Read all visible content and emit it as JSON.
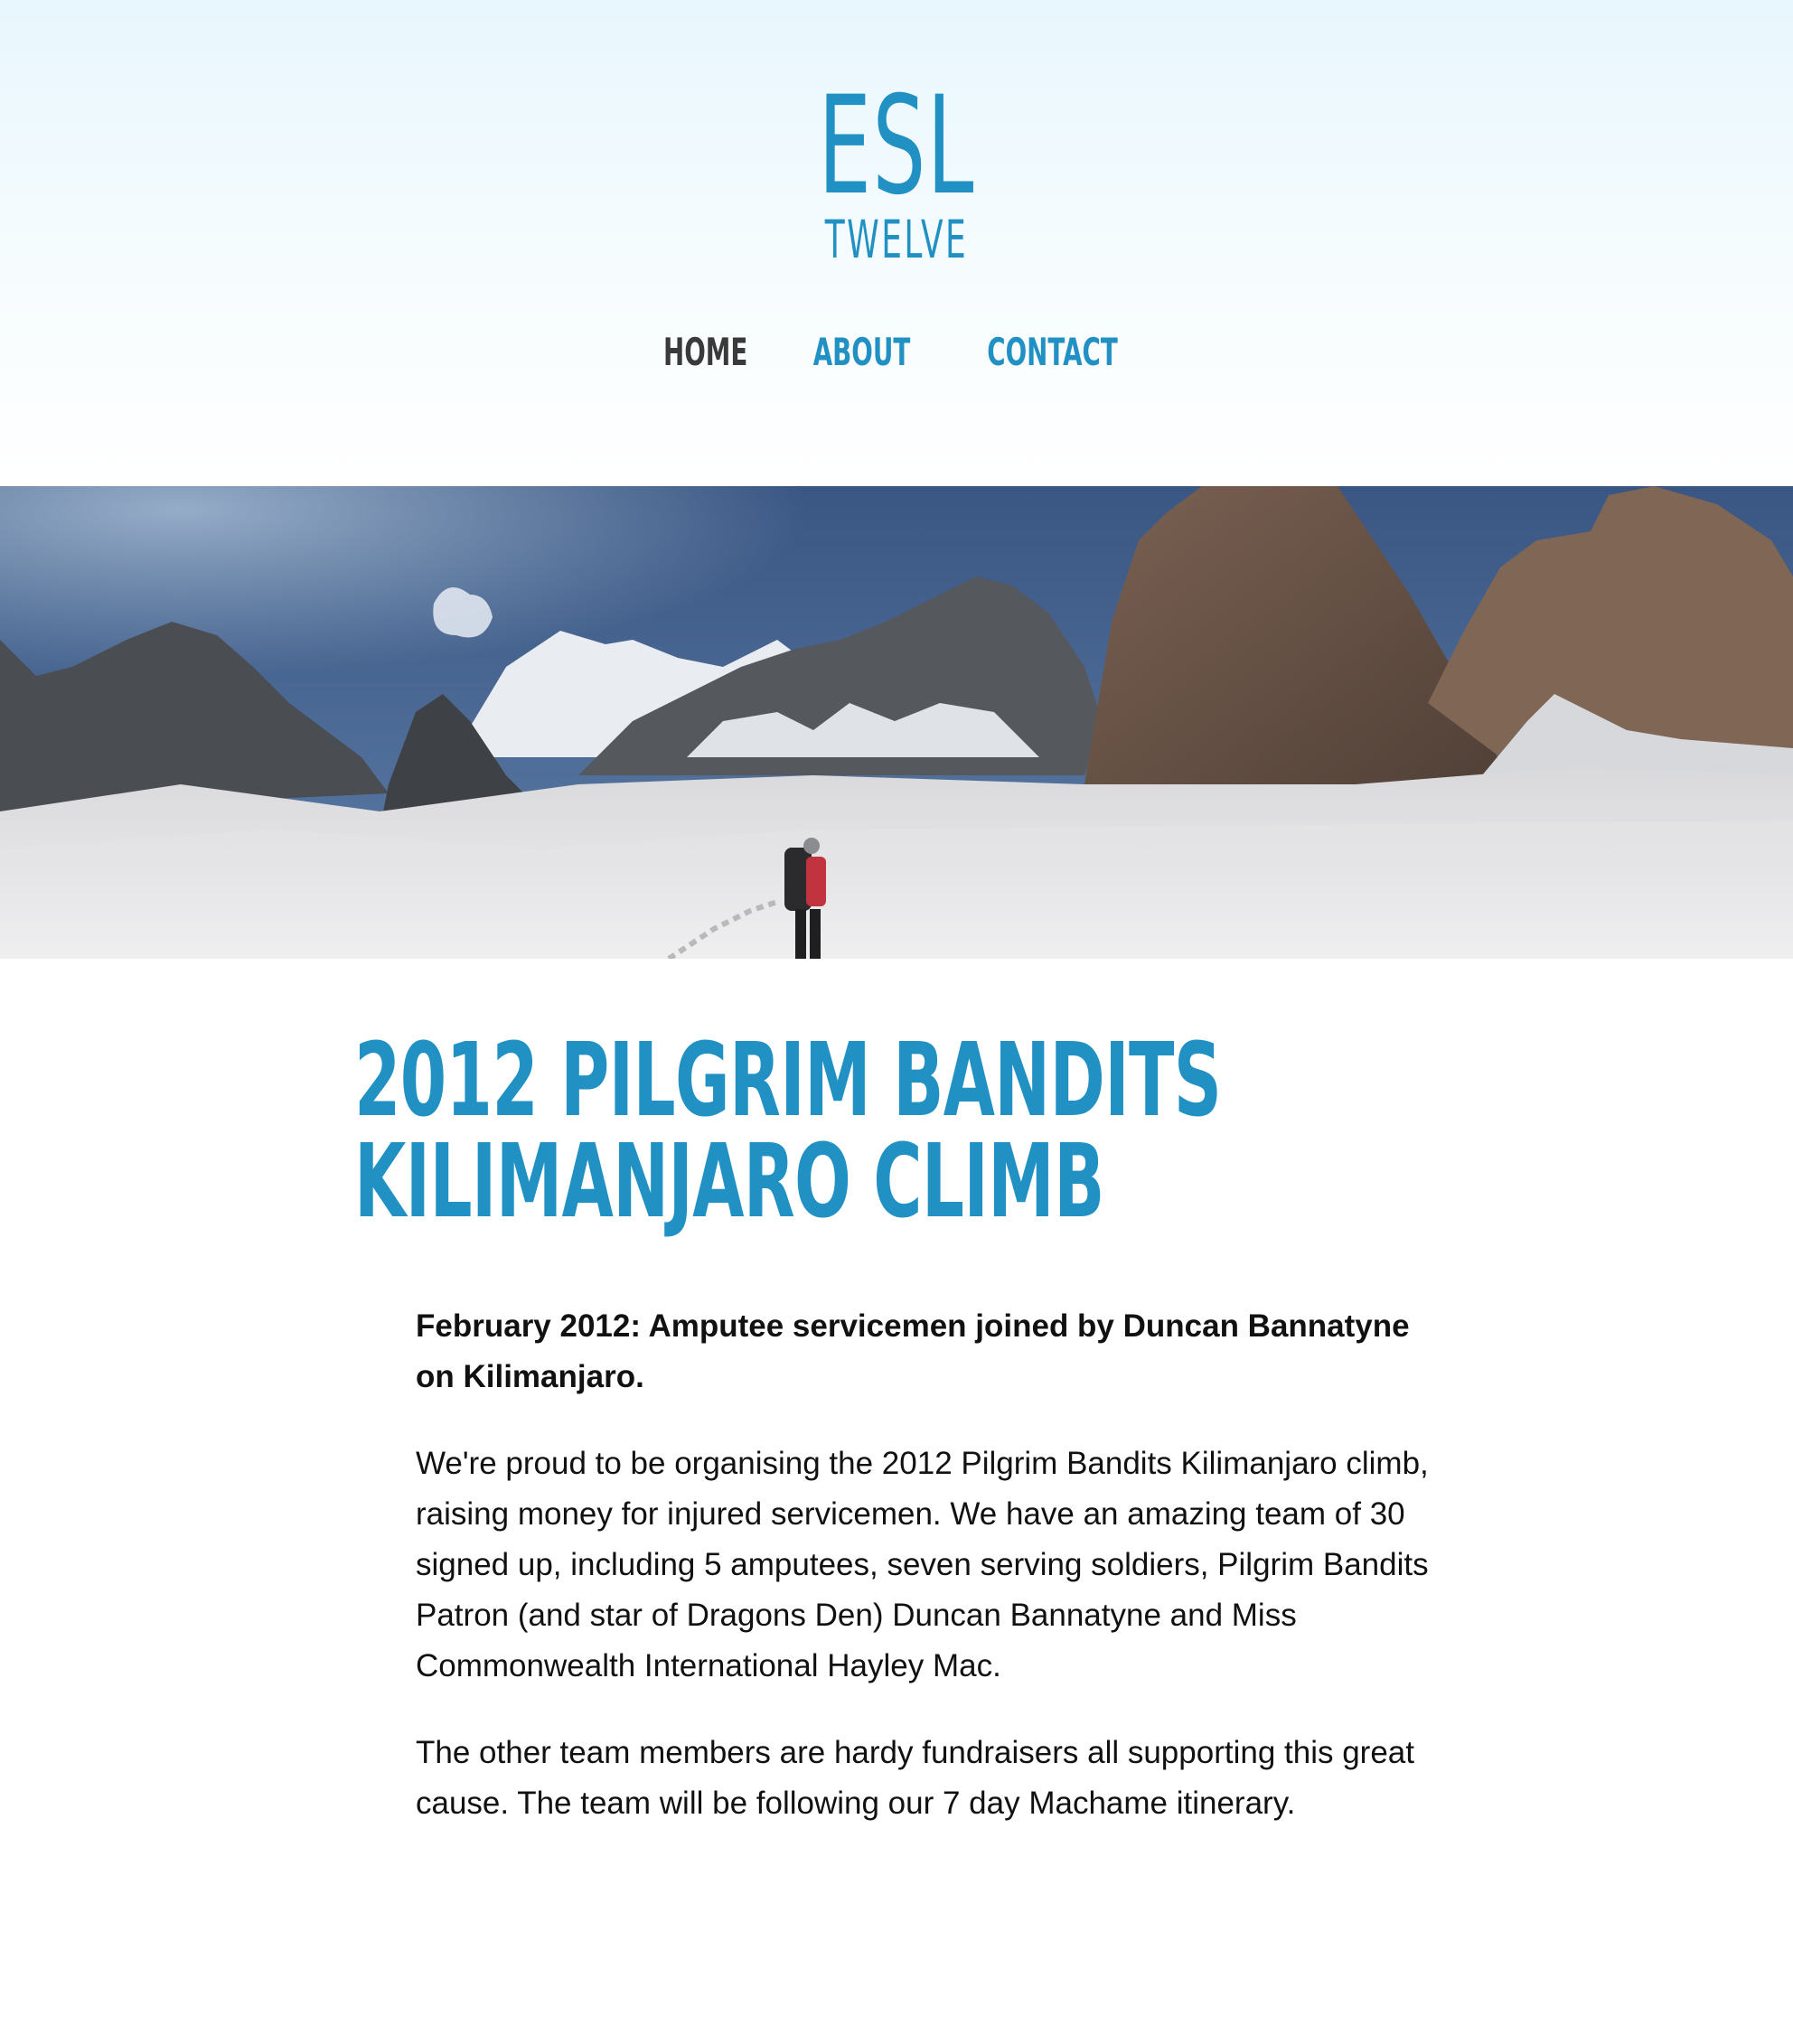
{
  "logo": {
    "main": "ESL",
    "sub": "TWELVE",
    "color": "#2191c4"
  },
  "nav": {
    "items": [
      {
        "label": "HOME",
        "active": true
      },
      {
        "label": "ABOUT",
        "active": false
      },
      {
        "label": "CONTACT",
        "active": false
      }
    ]
  },
  "hero": {
    "alt": "snowy-mountain-glacier-with-climber"
  },
  "article": {
    "title_line1": "2012 PILGRIM BANDITS",
    "title_line2": "KILIMANJARO CLIMB",
    "lead": "February 2012: Amputee servicemen joined by Duncan Bannatyne on Kilimanjaro.",
    "paragraph1": "We're proud to be organising the 2012 Pilgrim Bandits Kilimanjaro climb, raising money for injured servicemen. We have an amazing team of 30 signed up, including 5 amputees, seven serving soldiers, Pilgrim Bandits Patron (and star of Dragons Den) Duncan Bannatyne and Miss Commonwealth International Hayley Mac.",
    "paragraph2": "The other team members are hardy fundraisers all supporting this great cause. The team will be following our 7 day Machame itinerary."
  },
  "colors": {
    "accent": "#2191c4",
    "nav_active": "#3a3a3a",
    "text": "#111111"
  }
}
